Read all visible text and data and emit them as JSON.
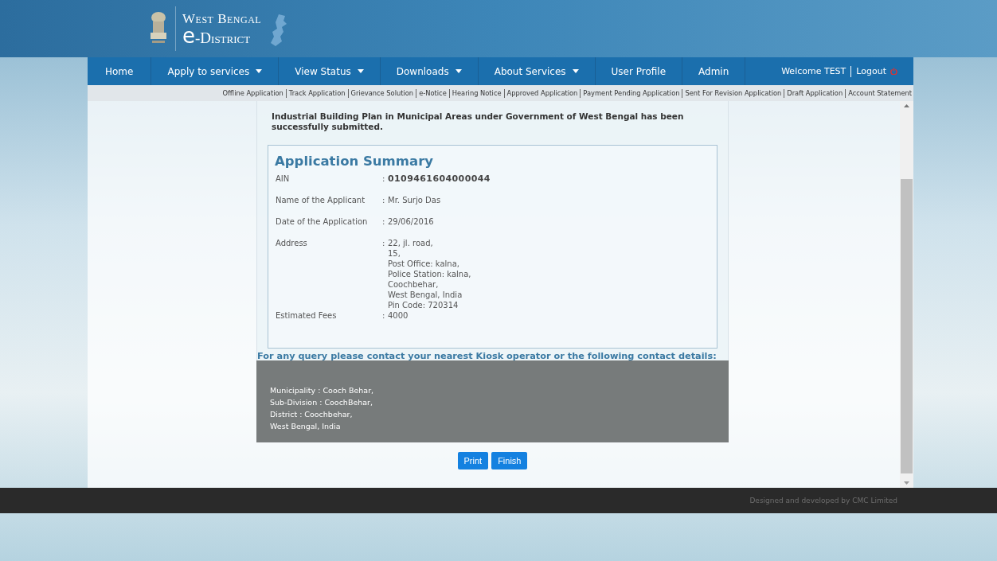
{
  "header": {
    "title_line1": "West Bengal",
    "title_line2_prefix": "e",
    "title_line2": "-District"
  },
  "nav": {
    "items": [
      {
        "label": "Home",
        "dropdown": false
      },
      {
        "label": "Apply to services",
        "dropdown": true
      },
      {
        "label": "View Status",
        "dropdown": true
      },
      {
        "label": "Downloads",
        "dropdown": true
      },
      {
        "label": "About Services",
        "dropdown": true
      },
      {
        "label": "User Profile",
        "dropdown": false
      },
      {
        "label": "Admin",
        "dropdown": false
      }
    ],
    "welcome": "Welcome TEST",
    "logout": "Logout"
  },
  "subnav": [
    "Offline Application",
    "Track Application",
    "Grievance Solution",
    "e-Notice",
    "Hearing Notice",
    "Approved Application",
    "Payment Pending Application",
    "Sent For Revision Application",
    "Draft Application",
    "Account Statement"
  ],
  "message": "Industrial Building Plan in Municipal Areas under Government of West Bengal has been successfully submitted.",
  "summary": {
    "title": "Application Summary",
    "separator": ":",
    "rows": [
      {
        "label": "AIN",
        "value": [
          "0109461604000044"
        ],
        "bold": true
      },
      {
        "label": "Name of the Applicant",
        "value": [
          "Mr. Surjo Das"
        ],
        "bold": false
      },
      {
        "label": "Date of the Application",
        "value": [
          "29/06/2016"
        ],
        "bold": false
      },
      {
        "label": "Address",
        "value": [
          "22, jl. road,",
          "15,",
          "Post Office: kalna,",
          "Police Station: kalna,",
          "Coochbehar,",
          "West Bengal, India",
          "Pin Code: 720314"
        ],
        "bold": false
      },
      {
        "label": "Estimated Fees",
        "value": [
          "4000"
        ],
        "bold": false
      }
    ]
  },
  "contact": {
    "heading": "For any query please contact your nearest Kiosk operator or the following contact details:",
    "lines": [
      "Municipality : Cooch Behar,",
      "Sub-Division : CoochBehar,",
      "District : Coochbehar,",
      "West Bengal, India"
    ]
  },
  "buttons": [
    "Print",
    "Finish"
  ],
  "footer": "Designed and developed by CMC Limited"
}
